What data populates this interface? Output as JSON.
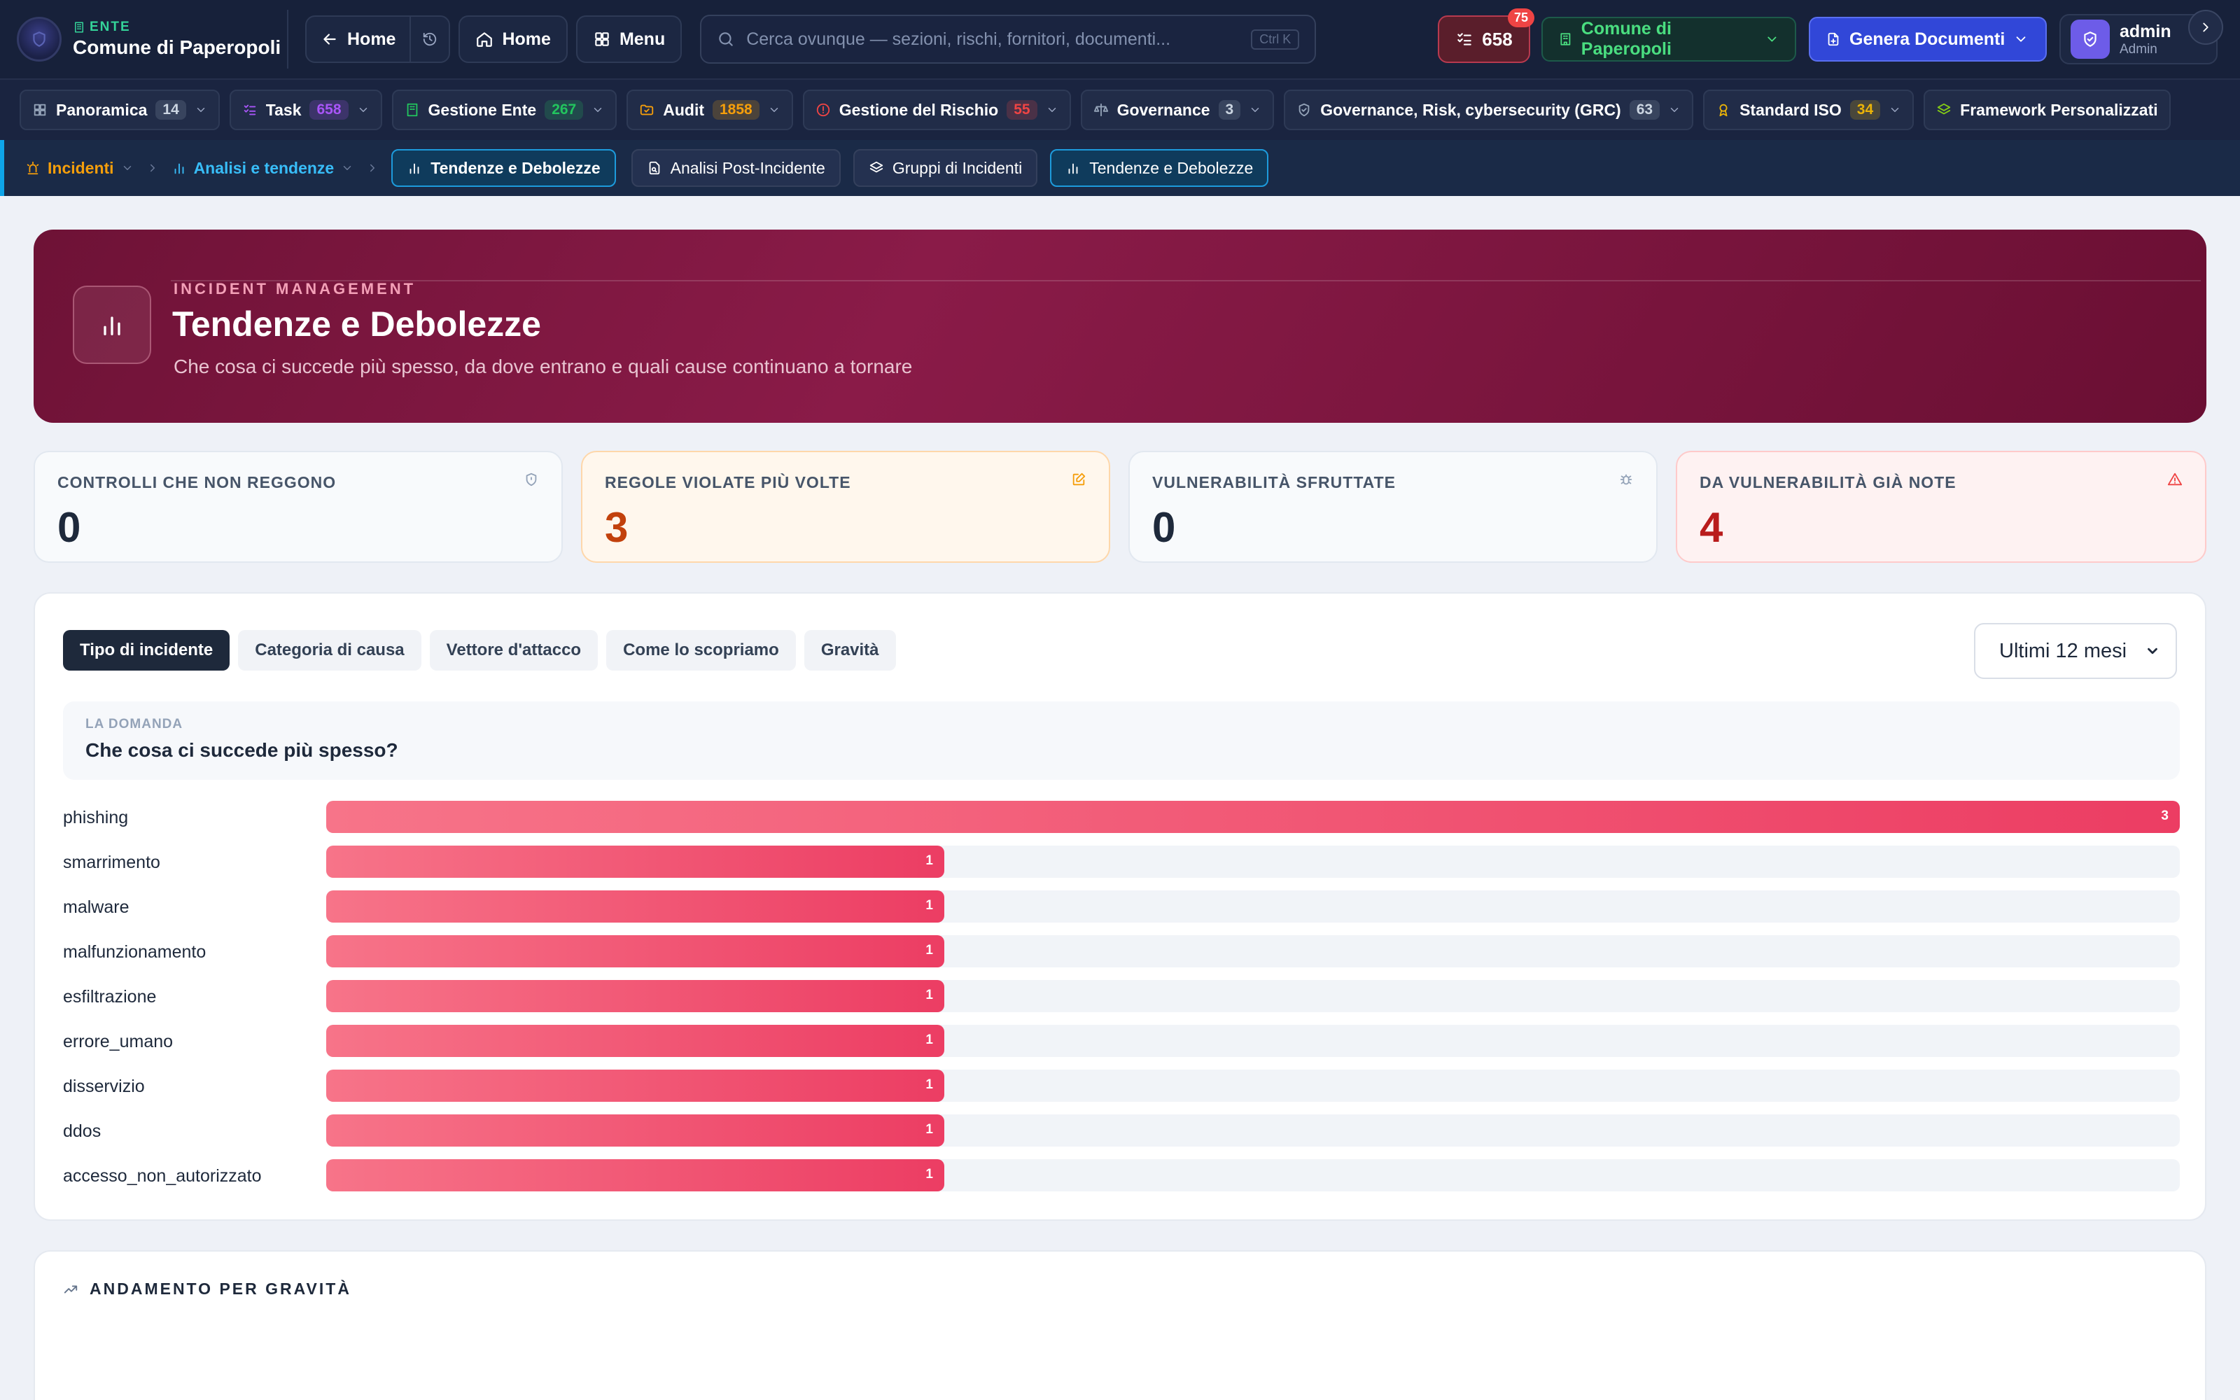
{
  "topbar": {
    "brand_kicker": "ENTE",
    "brand_name": "Comune di Paperopoli",
    "back_home": "Home",
    "home": "Home",
    "menu": "Menu",
    "search_placeholder": "Cerca ovunque — sezioni, rischi, fornitori, documenti...",
    "search_shortcut": "Ctrl K",
    "tasks_count": "658",
    "tasks_badge": "75",
    "ente_selector": "Comune di Paperopoli",
    "generate_docs": "Genera Documenti",
    "user_name": "admin",
    "user_role": "Admin"
  },
  "modules": [
    {
      "label": "Panoramica",
      "count": "14",
      "color": "#94a3b8"
    },
    {
      "label": "Task",
      "count": "658",
      "color": "#a855f7"
    },
    {
      "label": "Gestione Ente",
      "count": "267",
      "color": "#22c55e"
    },
    {
      "label": "Audit",
      "count": "1858",
      "color": "#f59e0b"
    },
    {
      "label": "Gestione del Rischio",
      "count": "55",
      "color": "#ef4444"
    },
    {
      "label": "Governance",
      "count": "3",
      "color": "#94a3b8"
    },
    {
      "label": "Governance, Risk, cybersecurity (GRC)",
      "count": "63",
      "color": "#94a3b8"
    },
    {
      "label": "Standard ISO",
      "count": "34",
      "color": "#eab308"
    },
    {
      "label": "Framework Personalizzati",
      "count": "",
      "color": "#84cc16"
    }
  ],
  "breadcrumb": {
    "section": "Incidenti",
    "subsection": "Analisi e tendenze",
    "current": "Tendenze e Debolezze",
    "links": [
      "Analisi Post-Incidente",
      "Gruppi di Incidenti",
      "Tendenze e Debolezze"
    ]
  },
  "hero": {
    "kicker": "INCIDENT MANAGEMENT",
    "title": "Tendenze e Debolezze",
    "subtitle": "Che cosa ci succede più spesso, da dove entrano e quali cause continuano a tornare"
  },
  "stats": [
    {
      "label": "CONTROLLI CHE NON REGGONO",
      "value": "0",
      "icon": "shield-icon"
    },
    {
      "label": "REGOLE VIOLATE PIÙ VOLTE",
      "value": "3",
      "icon": "edit-icon"
    },
    {
      "label": "VULNERABILITÀ SFRUTTATE",
      "value": "0",
      "icon": "bug-icon"
    },
    {
      "label": "DA VULNERABILITÀ GIÀ NOTE",
      "value": "4",
      "icon": "warning-icon"
    }
  ],
  "analysis": {
    "tabs": [
      "Tipo di incidente",
      "Categoria di causa",
      "Vettore d'attacco",
      "Come lo scopriamo",
      "Gravità"
    ],
    "period": "Ultimi 12 mesi",
    "question_kicker": "LA DOMANDA",
    "question": "Che cosa ci succede più spesso?"
  },
  "chart_data": {
    "type": "bar",
    "orientation": "horizontal",
    "categories": [
      "phishing",
      "smarrimento",
      "malware",
      "malfunzionamento",
      "esfiltrazione",
      "errore_umano",
      "disservizio",
      "ddos",
      "accesso_non_autorizzato"
    ],
    "values": [
      3,
      1,
      1,
      1,
      1,
      1,
      1,
      1,
      1
    ],
    "max": 3
  },
  "trend": {
    "title": "ANDAMENTO PER GRAVITÀ"
  }
}
